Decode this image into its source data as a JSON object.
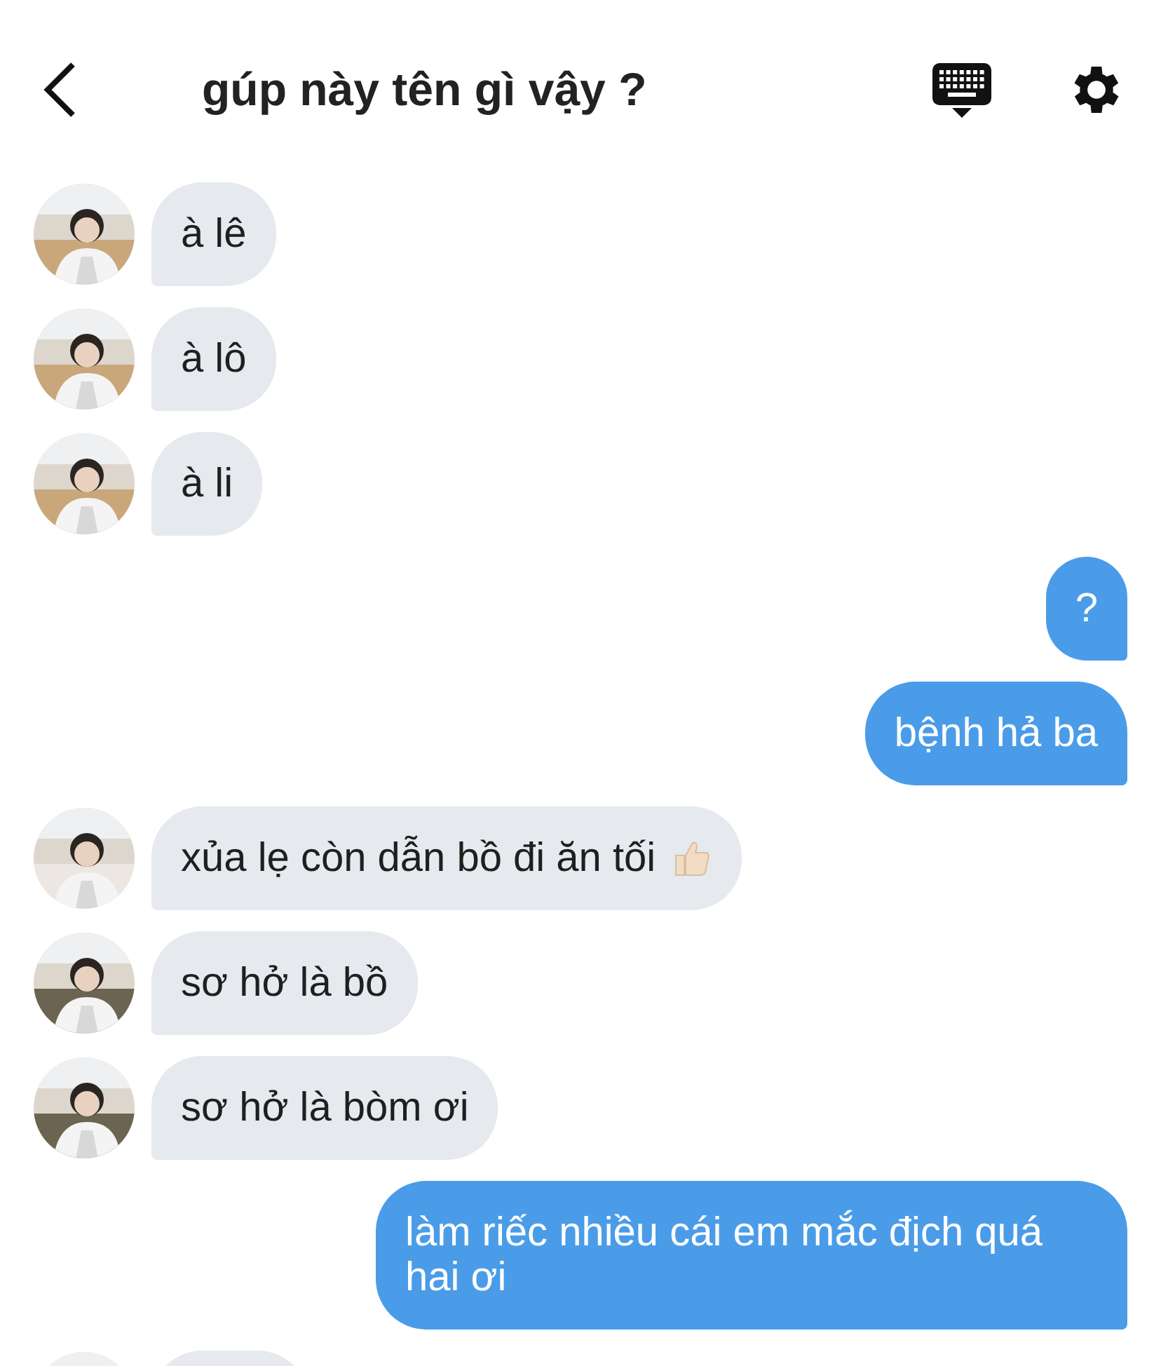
{
  "header": {
    "title": "gúp này tên gì vậy ?"
  },
  "messages": [
    {
      "kind": "received",
      "text": "à lê"
    },
    {
      "kind": "received",
      "text": "à lô"
    },
    {
      "kind": "received",
      "text": "à li"
    },
    {
      "kind": "sent",
      "text": "?"
    },
    {
      "kind": "sent",
      "text": "bệnh hả ba"
    },
    {
      "kind": "received",
      "text": "xủa lẹ còn dẫn bồ đi ăn tối",
      "thumbs_up": true
    },
    {
      "kind": "received",
      "text": "sơ hở là bồ"
    },
    {
      "kind": "received",
      "text": "sơ hở là bòm ơi"
    },
    {
      "kind": "sent",
      "text": "làm riếc nhiều cái em mắc địch quá hai ơi"
    },
    {
      "kind": "received"
    }
  ]
}
